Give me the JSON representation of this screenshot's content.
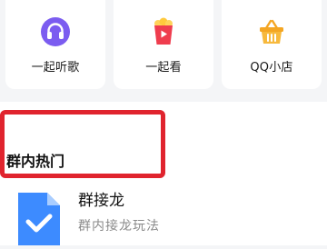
{
  "shortcuts": [
    {
      "label": "一起听歌",
      "icon": "headphones-icon",
      "color": "#7b5cf0"
    },
    {
      "label": "一起看",
      "icon": "popcorn-icon",
      "color": "#ef3d4e"
    },
    {
      "label": "QQ小店",
      "icon": "shopping-basket-icon",
      "color": "#f4a623"
    }
  ],
  "section": {
    "title": "群内热门",
    "highlight_color": "#e0242e"
  },
  "items": [
    {
      "title": "群接龙",
      "subtitle": "群内接龙玩法",
      "icon": "check-document-icon",
      "icon_color": "#3d8bff"
    }
  ]
}
